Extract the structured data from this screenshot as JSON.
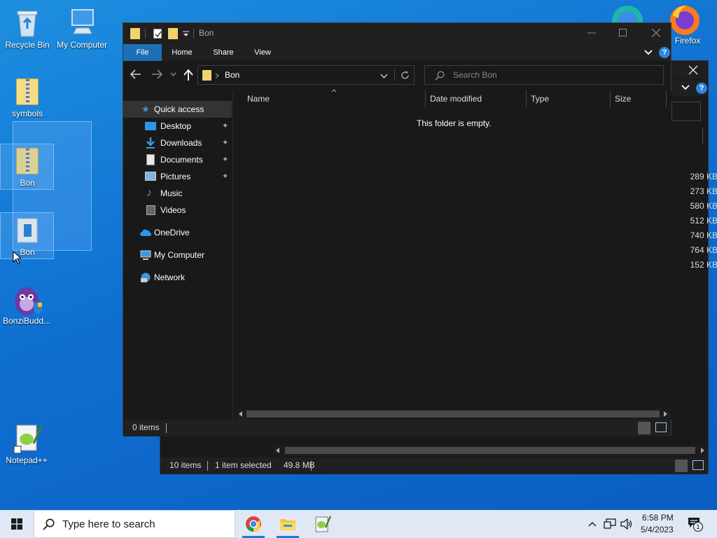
{
  "desktop": {
    "icons": [
      {
        "label": "Recycle Bin",
        "icon": "recycle-bin-icon"
      },
      {
        "label": "My Computer",
        "icon": "computer-icon"
      },
      {
        "label": "symbols",
        "icon": "zip-folder-icon"
      },
      {
        "label": "Bon",
        "icon": "zip-folder-icon"
      },
      {
        "label": "Bon",
        "icon": "folder-icon"
      },
      {
        "label": "BonziBudd...",
        "icon": "bonzibuddy-icon"
      },
      {
        "label": "Notepad++",
        "icon": "notepadpp-icon"
      },
      {
        "label": "Firefox",
        "icon": "firefox-icon"
      }
    ]
  },
  "bg_window": {
    "sizes": [
      "289 KB",
      "273 KB",
      "580 KB",
      "512 KB",
      "740 KB",
      "764 KB",
      "152 KB"
    ],
    "status_items": "10 items",
    "status_selected": "1 item selected",
    "status_size": "49.8 MB"
  },
  "explorer": {
    "title": "Bon",
    "ribbon_tabs": [
      "File",
      "Home",
      "Share",
      "View"
    ],
    "address": "Bon",
    "search_placeholder": "Search Bon",
    "nav": {
      "quick_access": "Quick access",
      "quick_items": [
        {
          "label": "Desktop",
          "icon": "desktop-folder-icon"
        },
        {
          "label": "Downloads",
          "icon": "downloads-icon"
        },
        {
          "label": "Documents",
          "icon": "documents-icon"
        },
        {
          "label": "Pictures",
          "icon": "pictures-icon"
        },
        {
          "label": "Music",
          "icon": "music-icon"
        },
        {
          "label": "Videos",
          "icon": "videos-icon"
        }
      ],
      "onedrive": "OneDrive",
      "my_computer": "My Computer",
      "network": "Network"
    },
    "columns": [
      "Name",
      "Date modified",
      "Type",
      "Size"
    ],
    "empty_message": "This folder is empty.",
    "status_items": "0 items"
  },
  "taskbar": {
    "search_placeholder": "Type here to search",
    "apps": [
      "chrome-icon",
      "file-explorer-icon",
      "notepadpp-icon"
    ],
    "clock_time": "6:58 PM",
    "clock_date": "5/4/2023",
    "notification_count": "1"
  }
}
